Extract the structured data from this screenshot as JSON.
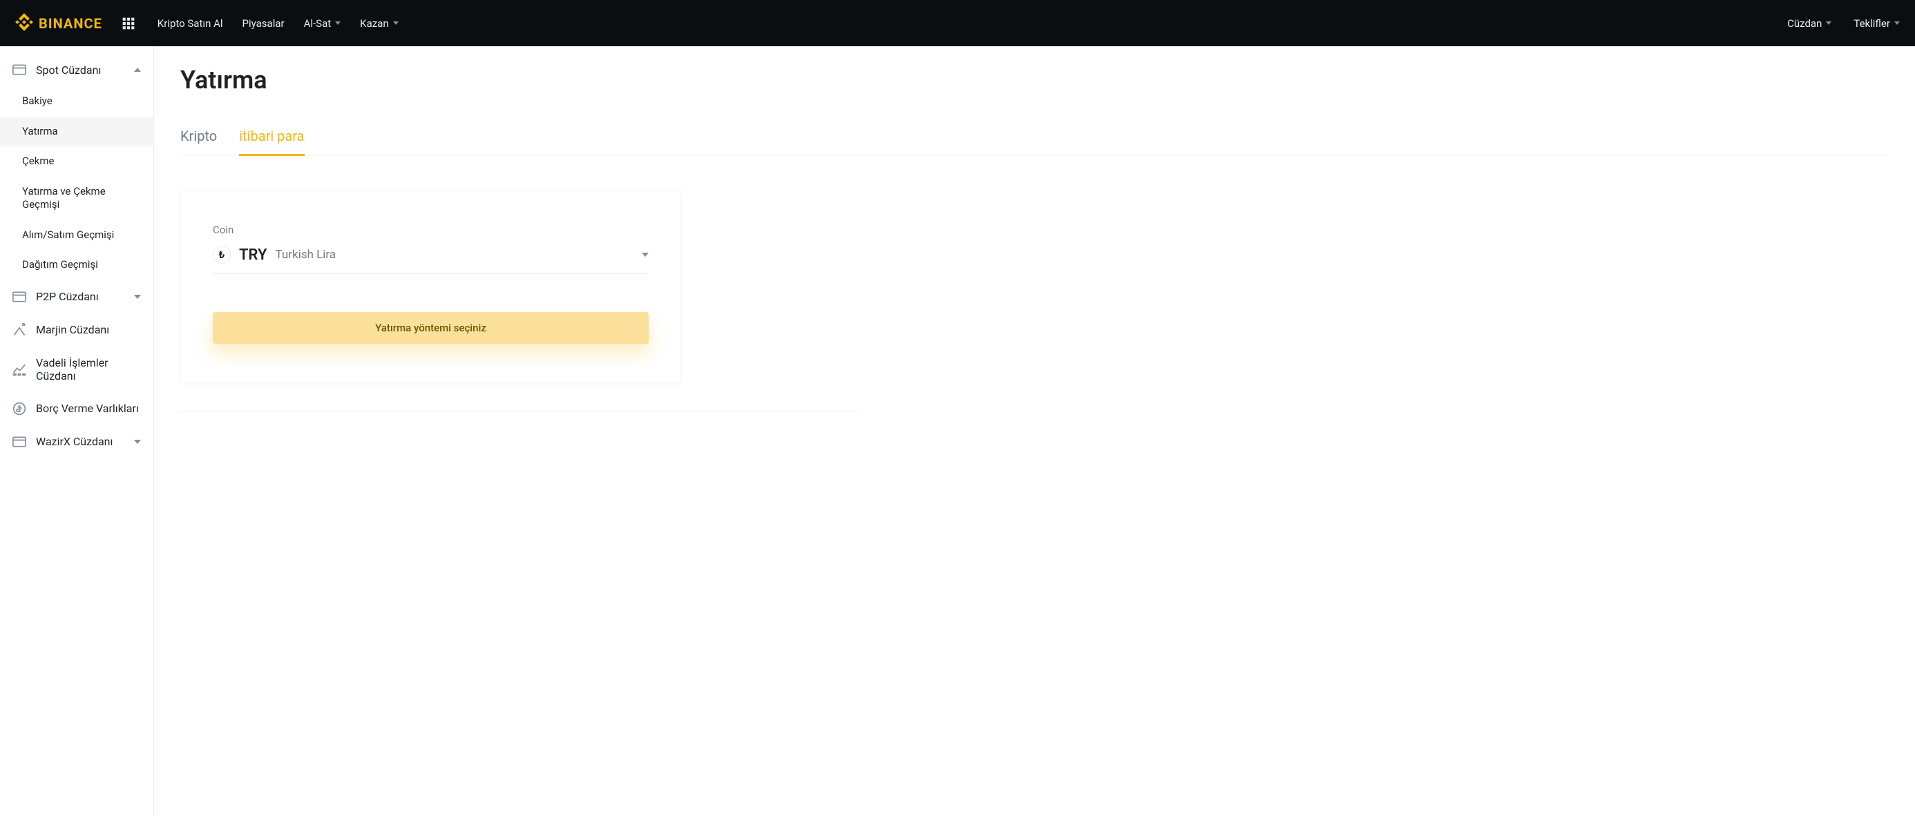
{
  "brand": "BINANCE",
  "header": {
    "nav": [
      {
        "label": "Kripto Satın Al",
        "dropdown": false
      },
      {
        "label": "Piyasalar",
        "dropdown": false
      },
      {
        "label": "Al-Sat",
        "dropdown": true
      },
      {
        "label": "Kazan",
        "dropdown": true
      }
    ],
    "right": [
      {
        "label": "Cüzdan",
        "dropdown": true
      },
      {
        "label": "Teklifler",
        "dropdown": true
      }
    ]
  },
  "sidebar": {
    "sections": [
      {
        "label": "Spot Cüzdanı",
        "icon": "wallet-icon",
        "expanded": true,
        "items": [
          {
            "label": "Bakiye",
            "active": false
          },
          {
            "label": "Yatırma",
            "active": true
          },
          {
            "label": "Çekme",
            "active": false
          },
          {
            "label": "Yatırma ve Çekme Geçmişi",
            "active": false
          },
          {
            "label": "Alım/Satım Geçmişi",
            "active": false
          },
          {
            "label": "Dağıtım Geçmişi",
            "active": false
          }
        ]
      },
      {
        "label": "P2P Cüzdanı",
        "icon": "wallet-icon",
        "expanded": false
      },
      {
        "label": "Marjin Cüzdanı",
        "icon": "margin-icon",
        "expanded": false
      },
      {
        "label": "Vadeli İşlemler Cüzdanı",
        "icon": "futures-icon",
        "expanded": false
      },
      {
        "label": "Borç Verme Varlıkları",
        "icon": "lending-icon",
        "expanded": false
      },
      {
        "label": "WazirX Cüzdanı",
        "icon": "wallet-icon",
        "expanded": false
      }
    ]
  },
  "main": {
    "title": "Yatırma",
    "tabs": [
      {
        "label": "Kripto",
        "active": false
      },
      {
        "label": "itibari para",
        "active": true
      }
    ],
    "coin_label": "Coin",
    "coin": {
      "symbol": "₺",
      "code": "TRY",
      "name": "Turkish Lira"
    },
    "method_btn": "Yatırma yöntemi seçiniz"
  }
}
